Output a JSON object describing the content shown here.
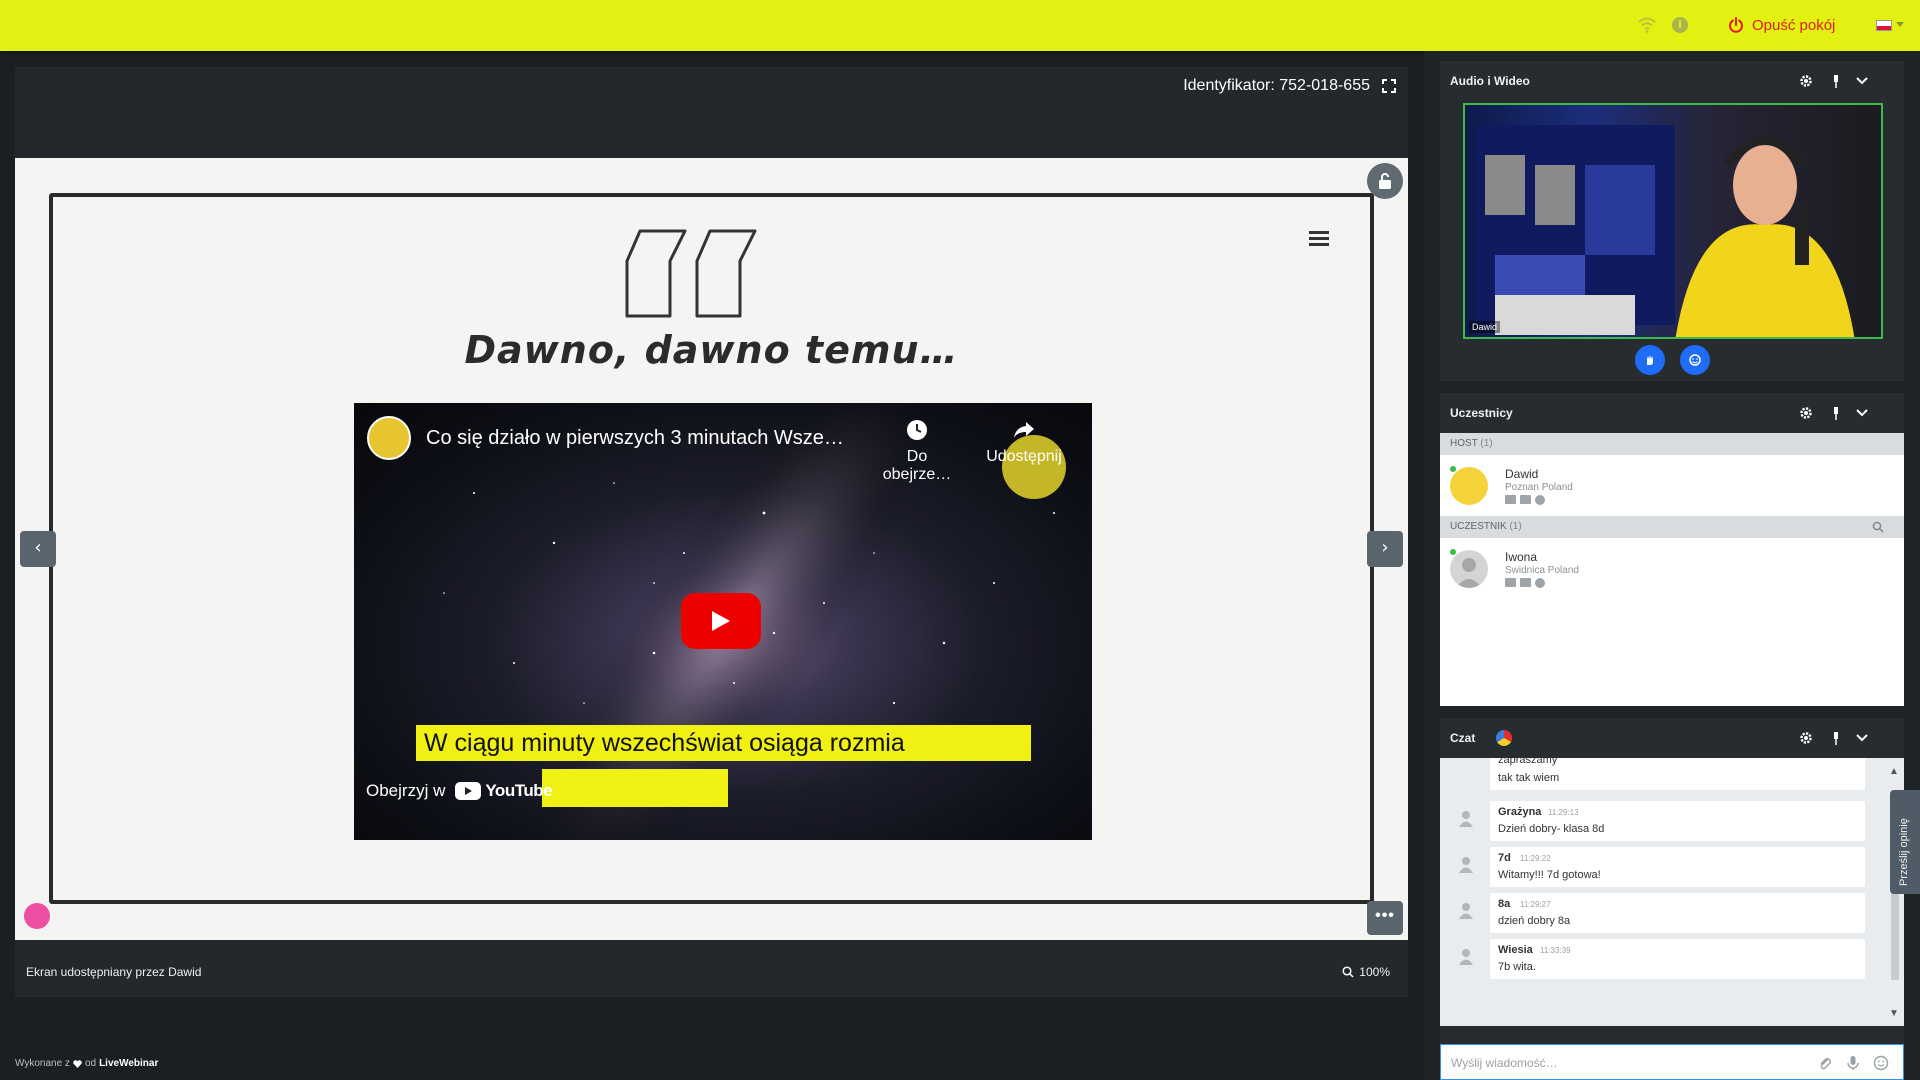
{
  "topbar": {
    "leave_label": "Opuść pokój",
    "colors": {
      "bar": "#e2f112",
      "leave": "#e01f1f"
    },
    "icons": [
      "wifi-icon",
      "info-icon",
      "power-icon",
      "flag-pl-icon"
    ]
  },
  "stage": {
    "meeting_id": "Identyfikator: 752-018-655",
    "slide_title": "Dawno, dawno temu…",
    "video": {
      "title": "Co się działo w pierwszych 3 minutach Wsze…",
      "watch_later_label": "Do obejrze…",
      "share_label": "Udostępnij",
      "caption": "W ciągu minuty wszechświat osiąga rozmia",
      "watch_on_label": "Obejrzyj w",
      "youtube_label": "YouTube"
    },
    "shared_by": "Ekran udostępniany przez Dawid",
    "zoom": "100%"
  },
  "credit": {
    "prefix": "Wykonane z",
    "middle": "od",
    "brand": "LiveWebinar"
  },
  "audio_video": {
    "title": "Audio i Wideo",
    "participant_name": "Dawid"
  },
  "participants": {
    "title": "Uczestnicy",
    "groups": [
      {
        "label": "HOST",
        "count": "(1)",
        "people": [
          {
            "name": "Dawid",
            "location": "Poznan Poland"
          }
        ]
      },
      {
        "label": "UCZESTNIK",
        "count": "(1)",
        "people": [
          {
            "name": "Iwona",
            "location": "Swidnica Poland"
          }
        ]
      }
    ]
  },
  "chat": {
    "title": "Czat",
    "partial_message": {
      "line1": "zapraszamy",
      "line2": "tak tak wiem"
    },
    "messages": [
      {
        "name": "Grażyna",
        "time": "11:29:13",
        "text": "Dzień dobry- klasa 8d"
      },
      {
        "name": "7d",
        "time": "11:29:22",
        "text": "Witamy!!! 7d gotowa!"
      },
      {
        "name": "8a",
        "time": "11:29:27",
        "text": "dzień dobry 8a"
      },
      {
        "name": "Wiesia",
        "time": "11:33:39",
        "text": "7b wita."
      }
    ],
    "input_placeholder": "Wyślij wiadomość…"
  },
  "feedback_label": "Prześlij opinię"
}
